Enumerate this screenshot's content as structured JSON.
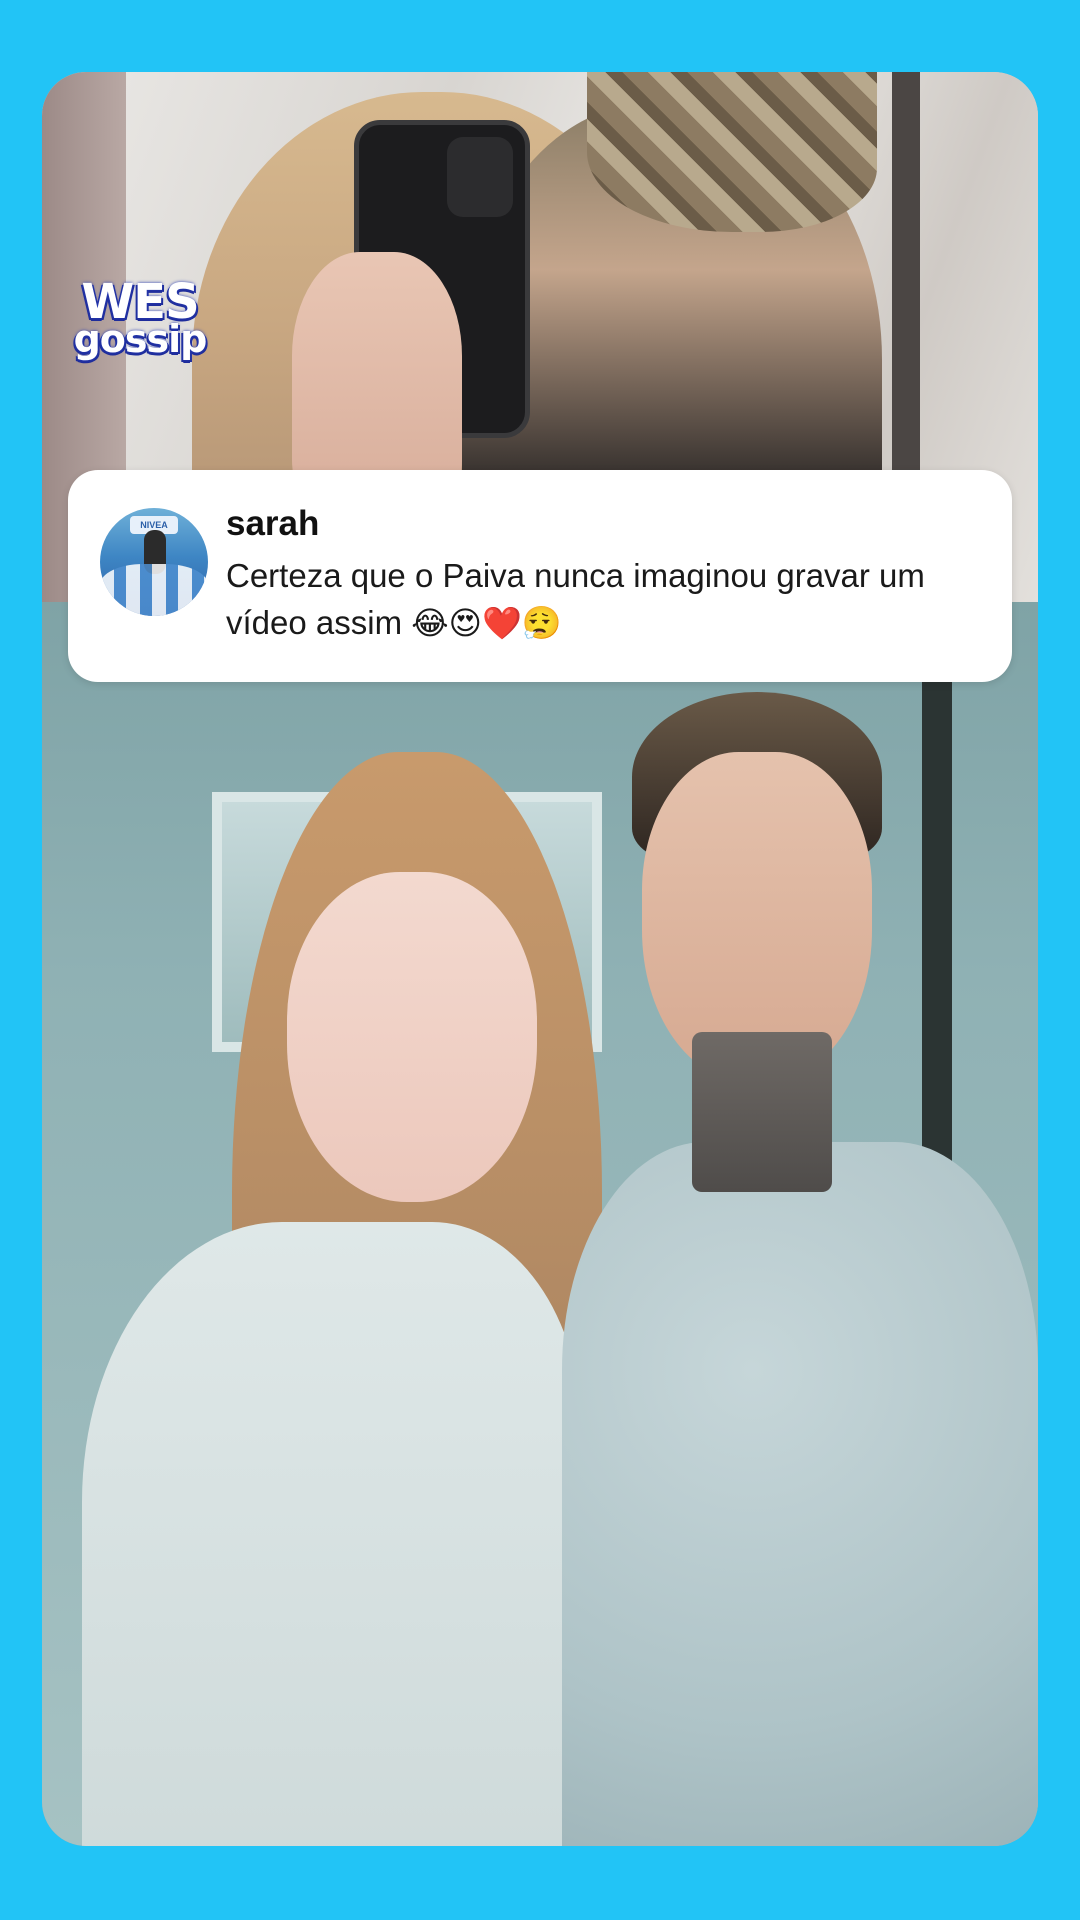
{
  "logo": {
    "line1": "WES",
    "line2": "gossip"
  },
  "comment": {
    "username": "sarah",
    "text": "Certeza que o Paiva nunca imaginou gravar um vídeo assim",
    "emojis": "😂😍❤️😮‍💨",
    "avatar_sign": "NIVEA"
  },
  "colors": {
    "background": "#22c4f6",
    "card": "#ffffff"
  }
}
